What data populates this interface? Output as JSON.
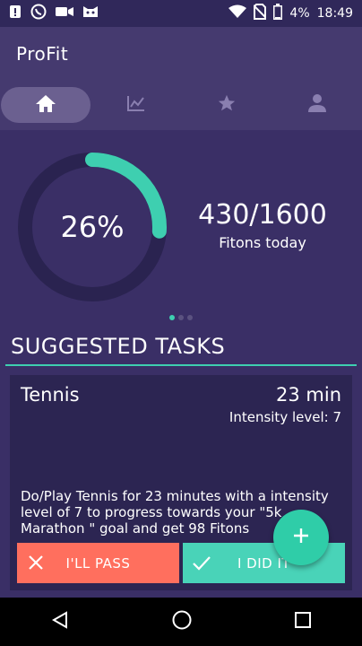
{
  "status_bar": {
    "battery": "4%",
    "time": "18:49"
  },
  "app": {
    "title": "ProFit"
  },
  "tabs": [
    {
      "icon": "home-icon"
    },
    {
      "icon": "chart-icon"
    },
    {
      "icon": "star-icon"
    },
    {
      "icon": "person-icon"
    }
  ],
  "summary": {
    "percent_label": "26%",
    "percent_value": 0.26,
    "fitons_value": "430/1600",
    "fitons_label": "Fitons today"
  },
  "section": {
    "title": "SUGGESTED TASKS"
  },
  "task": {
    "name": "Tennis",
    "duration": "23 min",
    "intensity": "Intensity level: 7",
    "description": "Do/Play  Tennis for 23 minutes with a intensity level of 7 to progress towards your \"5k Marathon \" goal and get 98 Fitons",
    "pass_label": "I'LL PASS",
    "done_label": "I DID IT"
  },
  "colors": {
    "accent": "#3ecfb0",
    "pass": "#ff6f5e",
    "done": "#49d3b8",
    "background": "#3a2f66"
  }
}
